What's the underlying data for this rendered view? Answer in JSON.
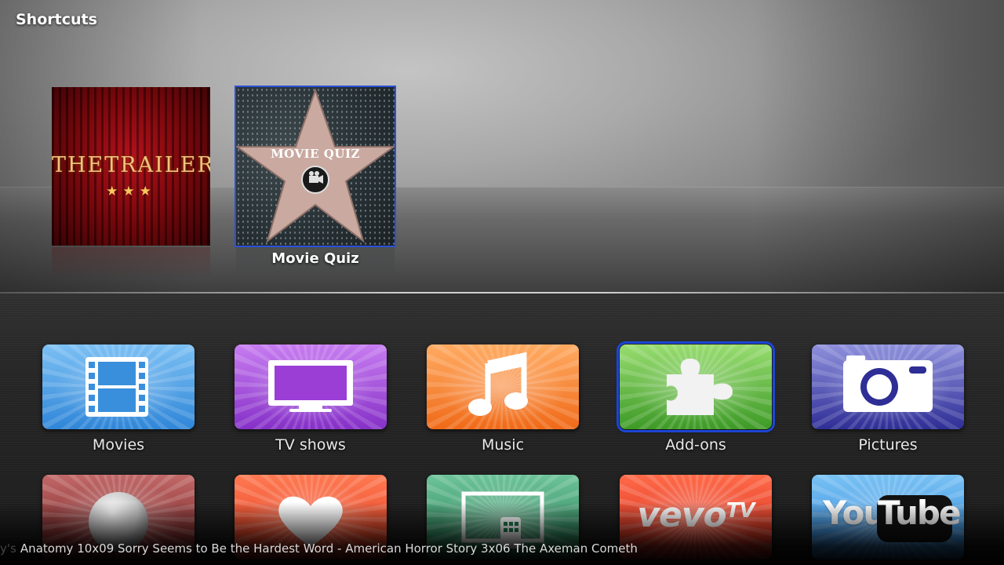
{
  "header": {
    "title": "Shortcuts"
  },
  "shortcuts": [
    {
      "name": "thetrailers",
      "art_text": "THETRAILERS",
      "art_stars": "★★★"
    },
    {
      "name": "movie-quiz",
      "art_text": "MOVIE QUIZ",
      "label": "Movie Quiz",
      "focused": true
    }
  ],
  "menu_row1": [
    {
      "label": "Movies",
      "icon": "film-strip-icon",
      "color": "#2f86d8"
    },
    {
      "label": "TV shows",
      "icon": "tv-icon",
      "color": "#8630c8"
    },
    {
      "label": "Music",
      "icon": "music-note-icon",
      "color": "#f06a18"
    },
    {
      "label": "Add-ons",
      "icon": "puzzle-piece-icon",
      "color": "#3d9a26",
      "focused": true
    },
    {
      "label": "Pictures",
      "icon": "camera-icon",
      "color": "#2e2e96"
    }
  ],
  "menu_row2": [
    {
      "icon": "moon-icon",
      "color": "#6c1a1a"
    },
    {
      "icon": "heart-icon",
      "color": "#e0351a"
    },
    {
      "icon": "remote-screen-icon",
      "color": "#1f7a50"
    },
    {
      "logo_text": "vevo",
      "logo_suffix": "TV",
      "color": "#d2281a"
    },
    {
      "logo_text": "You",
      "logo_suffix": "Tube",
      "color": "#2a82d8"
    }
  ],
  "ticker": {
    "lead": "y's",
    "text": "Anatomy 10x09 Sorry Seems to Be the Hardest Word - American Horror Story 3x06 The Axeman Cometh"
  },
  "colors": {
    "focus": "#1c46d6",
    "label": "#e8e8e8"
  }
}
